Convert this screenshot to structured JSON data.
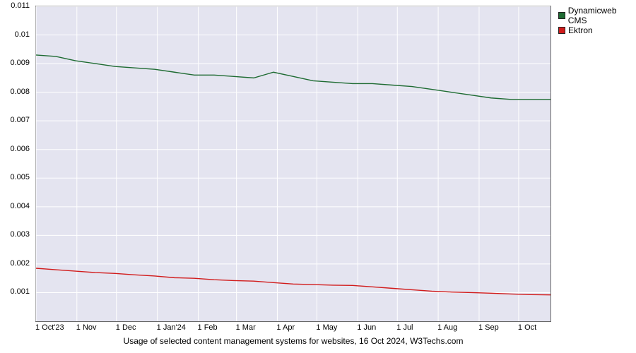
{
  "chart_data": {
    "type": "line",
    "title": "",
    "caption": "Usage of selected content management systems for websites, 16 Oct 2024, W3Techs.com",
    "xlabel": "",
    "ylabel": "",
    "ylim": [
      0,
      0.011
    ],
    "y_ticks": [
      0.001,
      0.002,
      0.003,
      0.004,
      0.005,
      0.006,
      0.007,
      0.008,
      0.009,
      0.01,
      0.011
    ],
    "y_tick_labels": [
      "0.001",
      "0.002",
      "0.003",
      "0.004",
      "0.005",
      "0.006",
      "0.007",
      "0.008",
      "0.009",
      "0.01",
      "0.011"
    ],
    "x_labels": [
      "1 Oct'23",
      "1 Nov",
      "1 Dec",
      "1 Jan'24",
      "1 Feb",
      "1 Mar",
      "1 Apr",
      "1 May",
      "1 Jun",
      "1 Jul",
      "1 Aug",
      "1 Sep",
      "1 Oct"
    ],
    "x_positions_frac": [
      0.0,
      0.0794,
      0.1563,
      0.2358,
      0.3153,
      0.3896,
      0.469,
      0.5459,
      0.6254,
      0.7023,
      0.7817,
      0.8612,
      0.9381
    ],
    "x_frac": [
      0.0,
      0.0385,
      0.0769,
      0.1154,
      0.1538,
      0.1923,
      0.2308,
      0.2692,
      0.3077,
      0.3462,
      0.3846,
      0.4231,
      0.4615,
      0.5,
      0.5385,
      0.5769,
      0.6154,
      0.6538,
      0.6923,
      0.7308,
      0.7692,
      0.8077,
      0.8462,
      0.8846,
      0.9231,
      0.9615,
      1.0
    ],
    "series": [
      {
        "name": "Dynamicweb CMS",
        "color": "#1e6b32",
        "values": [
          0.0093,
          0.00925,
          0.0091,
          0.009,
          0.0089,
          0.00885,
          0.0088,
          0.0087,
          0.0086,
          0.0086,
          0.00855,
          0.0085,
          0.0087,
          0.00855,
          0.0084,
          0.00835,
          0.0083,
          0.0083,
          0.00825,
          0.0082,
          0.0081,
          0.008,
          0.0079,
          0.0078,
          0.00775,
          0.00775,
          0.00775
        ]
      },
      {
        "name": "Ektron",
        "color": "#d11b1b",
        "values": [
          0.00185,
          0.0018,
          0.00175,
          0.0017,
          0.00167,
          0.00162,
          0.00158,
          0.00152,
          0.0015,
          0.00145,
          0.00142,
          0.0014,
          0.00135,
          0.0013,
          0.00128,
          0.00126,
          0.00125,
          0.0012,
          0.00115,
          0.0011,
          0.00105,
          0.00102,
          0.001,
          0.00098,
          0.00095,
          0.00093,
          0.00092
        ]
      }
    ]
  },
  "legend": {
    "items": [
      {
        "label": "Dynamicweb CMS",
        "color": "#1e6b32"
      },
      {
        "label": "Ektron",
        "color": "#d11b1b"
      }
    ]
  }
}
